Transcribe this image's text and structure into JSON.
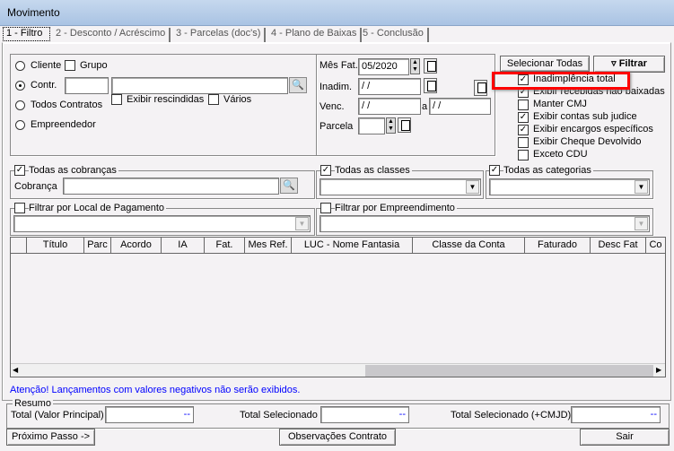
{
  "window": {
    "title": "Movimento"
  },
  "tabs": [
    "1 - Filtro",
    "2 - Desconto / Acréscimo",
    "3 - Parcelas (doc's)",
    "4 - Plano de Baixas",
    "5 - Conclusão"
  ],
  "selection": {
    "cliente": "Cliente",
    "grupo": "Grupo",
    "contr": "Contr.",
    "todos_contratos": "Todos Contratos",
    "empreendedor": "Empreendedor",
    "exibir_rescindidas": "Exibir rescindidas",
    "varios": "Vários",
    "selected": "Contr."
  },
  "dates": {
    "mes_fat_label": "Mês Fat.",
    "mes_fat_value": "05/2020",
    "inadim_label": "Inadim.",
    "inadim_value": " /  /",
    "venc_label": "Venc.",
    "venc_from": " /  /",
    "venc_sep": "a",
    "venc_to": " /  /",
    "parcela_label": "Parcela",
    "parcela_value": ""
  },
  "buttons": {
    "selecionar_todas": "Selecionar Todas",
    "filtrar": "Filtrar",
    "proximo": "Próximo Passo ->",
    "observacoes": "Observações Contrato",
    "sair": "Sair"
  },
  "options": [
    {
      "label": "Inadimplência total",
      "checked": true
    },
    {
      "label": "Exibir recebidas não baixadas",
      "checked": true
    },
    {
      "label": "Manter CMJ",
      "checked": false
    },
    {
      "label": "Exibir contas sub judice",
      "checked": true
    },
    {
      "label": "Exibir encargos específicos",
      "checked": true
    },
    {
      "label": "Exibir Cheque Devolvido",
      "checked": false
    },
    {
      "label": "Exceto CDU",
      "checked": false
    }
  ],
  "highlight_color": "#ff0000",
  "filters": {
    "cobrancas": "Todas as cobranças",
    "cobranca_label": "Cobrança",
    "classes": "Todas as classes",
    "categorias": "Todas as categorias",
    "local_pagamento": "Filtrar por Local de Pagamento",
    "empreendimento": "Filtrar por Empreendimento"
  },
  "grid": {
    "columns": [
      "Título",
      "Parc",
      "Acordo",
      "IA",
      "Fat.",
      "Mes Ref.",
      "LUC - Nome Fantasia",
      "Classe da Conta",
      "Faturado",
      "Desc Fat",
      "Co"
    ]
  },
  "warning": "Atenção! Lançamentos com valores negativos não serão exibidos.",
  "resumo": {
    "title": "Resumo",
    "total_principal": "Total (Valor Principal)",
    "total_selecionado": "Total Selecionado",
    "total_cmjd": "Total Selecionado (+CMJD)",
    "empty_value": "--"
  }
}
